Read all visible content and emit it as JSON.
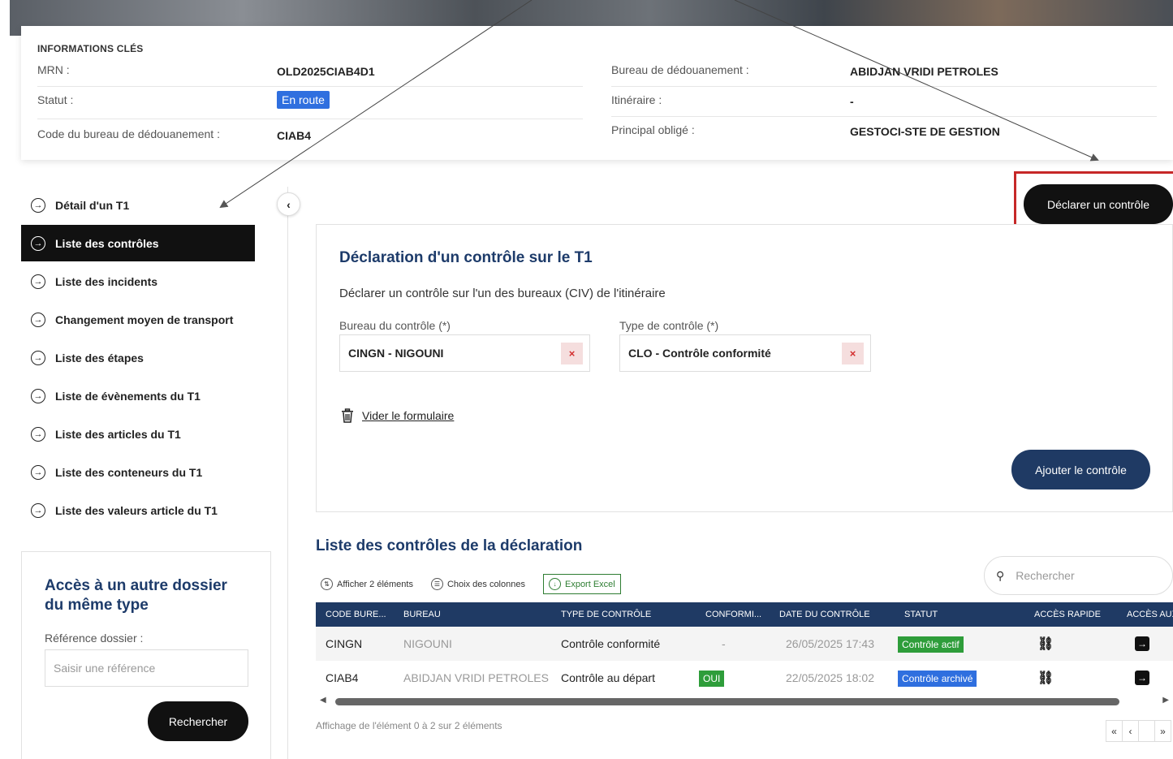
{
  "info": {
    "title": "INFORMATIONS CLÉS",
    "mrn_label": "MRN :",
    "mrn_value": "OLD2025CIAB4D1",
    "statut_label": "Statut :",
    "statut_value": "En route",
    "code_label": "Code du bureau de dédouanement :",
    "code_value": "CIAB4",
    "bureau_label": "Bureau de dédouanement :",
    "bureau_value": "ABIDJAN VRIDI PETROLES",
    "itineraire_label": "Itinéraire :",
    "itineraire_value": "-",
    "principal_label": "Principal obligé :",
    "principal_value": "GESTOCI-STE DE GESTION"
  },
  "nav": {
    "items": [
      {
        "label": "Détail d'un T1",
        "active": false
      },
      {
        "label": "Liste des contrôles",
        "active": true
      },
      {
        "label": "Liste des incidents",
        "active": false
      },
      {
        "label": "Changement moyen de transport",
        "active": false
      },
      {
        "label": "Liste des étapes",
        "active": false
      },
      {
        "label": "Liste de évènements du T1",
        "active": false
      },
      {
        "label": "Liste des articles du T1",
        "active": false
      },
      {
        "label": "Liste des conteneurs du T1",
        "active": false
      },
      {
        "label": "Liste des valeurs article du T1",
        "active": false
      }
    ]
  },
  "access": {
    "title": "Accès à un autre dossier du même type",
    "label": "Référence dossier :",
    "placeholder": "Saisir une référence",
    "button": "Rechercher"
  },
  "declare_button": "Déclarer un contrôle",
  "form": {
    "title": "Déclaration d'un contrôle sur le T1",
    "subtitle": "Déclarer un contrôle sur l'un des bureaux (CIV) de l'itinéraire",
    "bureau_label": "Bureau du contrôle (*)",
    "bureau_value": "CINGN - NIGOUNI",
    "type_label": "Type de contrôle (*)",
    "type_value": "CLO - Contrôle conformité",
    "clear_symbol": "×",
    "reset_label": "Vider le formulaire",
    "add_button": "Ajouter le contrôle"
  },
  "list": {
    "title": "Liste des contrôles de la déclaration",
    "show_label": "Afficher 2 éléments",
    "columns_label": "Choix des colonnes",
    "export_label": "Export Excel",
    "search_placeholder": "Rechercher",
    "headers": [
      "CODE BURE...",
      "BUREAU",
      "TYPE DE CONTRÔLE",
      "CONFORMI...",
      "DATE DU CONTRÔLE",
      "STATUT",
      "ACCÈS RAPIDE",
      "ACCÈS AUX"
    ],
    "rows": [
      {
        "code": "CINGN",
        "bureau": "NIGOUNI",
        "type": "Contrôle conformité",
        "conformite": "-",
        "date": "26/05/2025 17:43",
        "statut": "Contrôle actif",
        "statut_color": "#2e9d3a"
      },
      {
        "code": "CIAB4",
        "bureau": "ABIDJAN VRIDI PETROLES",
        "type": "Contrôle au départ",
        "conformite": "OUI",
        "date": "22/05/2025 18:02",
        "statut": "Contrôle archivé",
        "statut_color": "#2f6fdf"
      }
    ],
    "footer": "Affichage de l'élément 0 à 2 sur 2 éléments",
    "pager": [
      "«",
      "‹",
      "",
      "»"
    ]
  },
  "colors": {
    "navy": "#1f3a64",
    "title_blue": "#1d3b6a",
    "green": "#2e9d3a",
    "blue": "#2f6fdf",
    "highlight_red": "#c62828"
  }
}
